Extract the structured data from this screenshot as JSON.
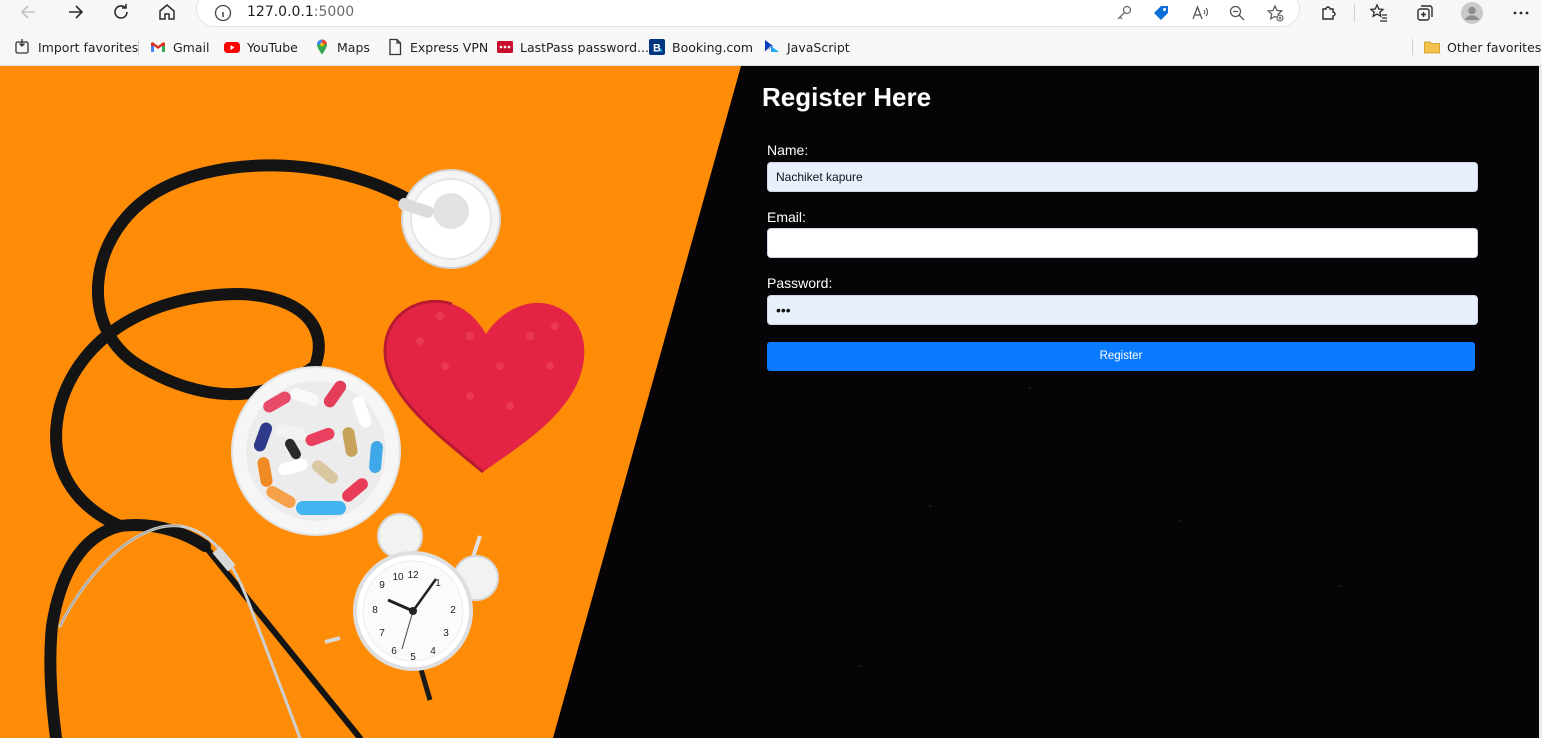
{
  "browser": {
    "url_host": "127.0.0.1",
    "url_port": ":5000",
    "favorites": [
      {
        "label": "Import favorites",
        "icon": "import-icon"
      },
      {
        "label": "Gmail",
        "icon": "gmail-icon"
      },
      {
        "label": "YouTube",
        "icon": "youtube-icon"
      },
      {
        "label": "Maps",
        "icon": "maps-icon"
      },
      {
        "label": "Express VPN",
        "icon": "page-icon"
      },
      {
        "label": "LastPass password...",
        "icon": "lastpass-icon"
      },
      {
        "label": "Booking.com",
        "icon": "booking-icon"
      },
      {
        "label": "JavaScript",
        "icon": "javascript-icon"
      }
    ],
    "other_favorites": "Other favorites"
  },
  "form": {
    "title": "Register Here",
    "name_label": "Name:",
    "name_value": "Nachiket kapure",
    "email_label": "Email:",
    "email_value": "",
    "password_label": "Password:",
    "password_value": "•••",
    "submit_label": "Register"
  },
  "colors": {
    "hero_orange": "#ff8c06",
    "panel_black": "#060406",
    "button_blue": "#0a7aff",
    "autofill_bg": "#e8f0fe"
  }
}
